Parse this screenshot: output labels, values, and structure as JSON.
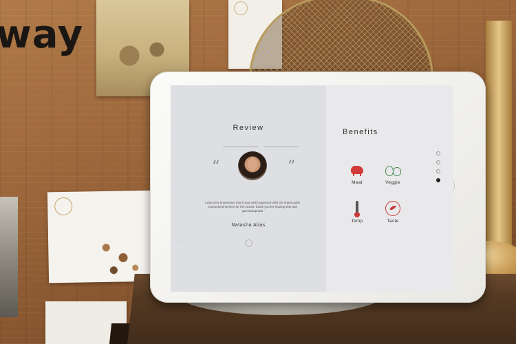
{
  "wall": {
    "text": "way"
  },
  "review": {
    "title": "Review",
    "tabs": [
      "",
      ""
    ],
    "quote_open": "“",
    "quote_close": "”",
    "text": "I was very impressive that it was well organized with the impeccable customized service for the tourist. thank you for sharing this and gamsahapnida",
    "name": "Natasha Alias"
  },
  "benefits": {
    "title": "Benefits",
    "items": [
      {
        "label": "Meat",
        "icon": "pig-icon",
        "color": "#d23a3a"
      },
      {
        "label": "Veggie",
        "icon": "vegetable-icon",
        "color": "#4c8f5a"
      },
      {
        "label": "Temp",
        "icon": "thermometer-icon",
        "color": "#c63a3a"
      },
      {
        "label": "Taste",
        "icon": "chili-icon",
        "color": "#c63a3a"
      }
    ]
  },
  "pagination": {
    "count": 4,
    "active_index": 3
  },
  "colors": {
    "tablet_body": "#f4f4f1",
    "screen_bg": "#e6e6e8",
    "accent_red": "#d23a3a",
    "accent_green": "#4c8f5a"
  }
}
